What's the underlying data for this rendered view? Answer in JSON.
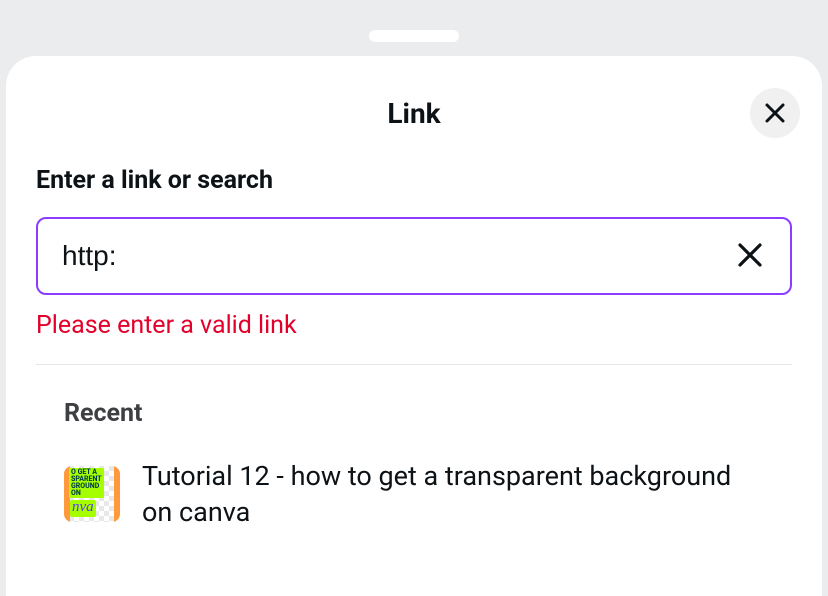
{
  "header": {
    "title": "Link"
  },
  "form": {
    "label": "Enter a link or search",
    "input_value": "http:",
    "error": "Please enter a valid link"
  },
  "recent": {
    "heading": "Recent",
    "items": [
      {
        "title": "Tutorial 12 - how to get a transparent background on canva"
      }
    ]
  }
}
